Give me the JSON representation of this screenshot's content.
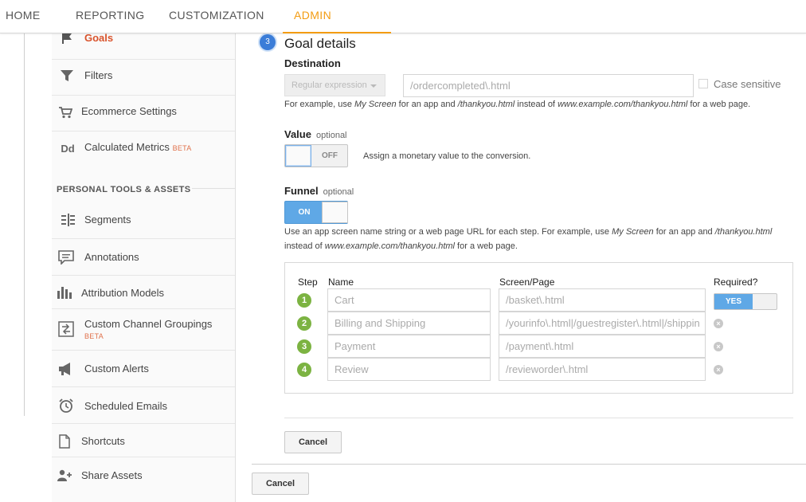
{
  "nav": {
    "tabs": [
      {
        "label": "HOME"
      },
      {
        "label": "REPORTING"
      },
      {
        "label": "CUSTOMIZATION"
      },
      {
        "label": "ADMIN",
        "active": true
      }
    ],
    "accent_color": "#f39c12"
  },
  "sidebar": {
    "items": [
      {
        "label": "Goals",
        "icon": "flag-icon",
        "active": true
      },
      {
        "label": "Filters",
        "icon": "filter-icon"
      },
      {
        "label": "Ecommerce Settings",
        "icon": "cart-icon"
      },
      {
        "label": "Calculated Metrics",
        "icon": "dd-icon",
        "badge": "BETA"
      }
    ],
    "section_heading": "PERSONAL TOOLS & ASSETS",
    "tools": [
      {
        "label": "Segments",
        "icon": "segments-icon"
      },
      {
        "label": "Annotations",
        "icon": "annotation-icon"
      },
      {
        "label": "Attribution Models",
        "icon": "bar-chart-icon"
      },
      {
        "label": "Custom Channel Groupings",
        "icon": "channel-grouping-icon",
        "badge": "BETA"
      },
      {
        "label": "Custom Alerts",
        "icon": "megaphone-icon"
      },
      {
        "label": "Scheduled Emails",
        "icon": "alarm-clock-icon"
      },
      {
        "label": "Shortcuts",
        "icon": "document-icon"
      },
      {
        "label": "Share Assets",
        "icon": "add-user-icon"
      }
    ]
  },
  "goal_details": {
    "step_number": "3",
    "title": "Goal details",
    "destination": {
      "label": "Destination",
      "match_type": "Regular expression",
      "value": "/ordercompleted\\.html",
      "case_sensitive_label": "Case sensitive",
      "hint_parts": [
        "For example, use ",
        "My Screen",
        " for an app and ",
        "/thankyou.html",
        " instead of ",
        "www.example.com/thankyou.html",
        " for a web page."
      ]
    },
    "value": {
      "label": "Value",
      "optional": "optional",
      "toggle": "OFF",
      "hint": "Assign a monetary value to the conversion."
    },
    "funnel": {
      "label": "Funnel",
      "optional": "optional",
      "toggle": "ON",
      "hint_line1_parts": [
        "Use an app screen name string or a web page URL for each step. For example, use ",
        "My Screen",
        " for an app and ",
        "/thankyou.html"
      ],
      "hint_line2_parts": [
        "instead of ",
        "www.example.com/thankyou.html",
        " for a web page."
      ],
      "columns": {
        "step": "Step",
        "name": "Name",
        "screen": "Screen/Page",
        "required": "Required?"
      },
      "required_toggle": "YES",
      "steps": [
        {
          "num": "1",
          "name": "Cart",
          "screen": "/basket\\.html"
        },
        {
          "num": "2",
          "name": "Billing and Shipping",
          "screen": "/yourinfo\\.html|/guestregister\\.html|/shippin"
        },
        {
          "num": "3",
          "name": "Payment",
          "screen": "/payment\\.html"
        },
        {
          "num": "4",
          "name": "Review",
          "screen": "/revieworder\\.html"
        }
      ]
    },
    "cancel_label": "Cancel"
  },
  "outer_cancel_label": "Cancel"
}
